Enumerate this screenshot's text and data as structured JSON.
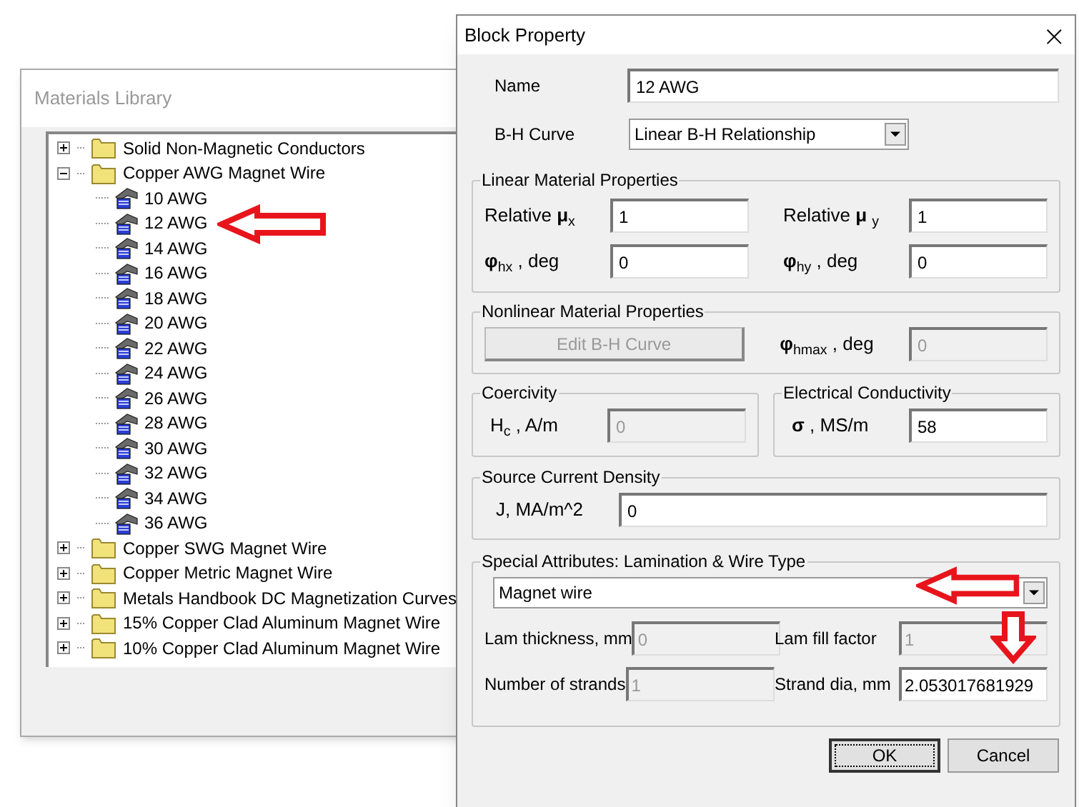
{
  "materials_library": {
    "title": "Materials Library",
    "tree": [
      {
        "label": "Solid Non-Magnetic Conductors",
        "expanded": false
      },
      {
        "label": "Copper AWG Magnet Wire",
        "expanded": true,
        "children": [
          {
            "label": "10 AWG",
            "marked": false
          },
          {
            "label": "12 AWG",
            "marked": true
          },
          {
            "label": "14 AWG",
            "marked": false
          },
          {
            "label": "16 AWG",
            "marked": false
          },
          {
            "label": "18 AWG",
            "marked": false
          },
          {
            "label": "20 AWG",
            "marked": false
          },
          {
            "label": "22 AWG",
            "marked": false
          },
          {
            "label": "24 AWG",
            "marked": false
          },
          {
            "label": "26 AWG",
            "marked": false
          },
          {
            "label": "28 AWG",
            "marked": false
          },
          {
            "label": "30 AWG",
            "marked": false
          },
          {
            "label": "32 AWG",
            "marked": false
          },
          {
            "label": "34 AWG",
            "marked": false
          },
          {
            "label": "36 AWG",
            "marked": false
          }
        ]
      },
      {
        "label": "Copper SWG Magnet Wire",
        "expanded": false
      },
      {
        "label": "Copper Metric Magnet Wire",
        "expanded": false
      },
      {
        "label": "Metals Handbook DC Magnetization Curves",
        "expanded": false
      },
      {
        "label": "15% Copper Clad Aluminum Magnet Wire",
        "expanded": false
      },
      {
        "label": "10% Copper Clad Aluminum Magnet Wire",
        "expanded": false
      }
    ]
  },
  "block_property": {
    "title": "Block Property",
    "close": "×",
    "name": {
      "label": "Name",
      "value": "12 AWG"
    },
    "bh_curve": {
      "label": "B-H Curve",
      "value": "Linear B-H Relationship"
    },
    "linear": {
      "title": "Linear Material Properties",
      "fields": [
        {
          "label": "Relative **μ**$_{x}$",
          "value": "1",
          "disabled": false
        },
        {
          "label": "Relative **μ** $_{y}$",
          "value": "1",
          "disabled": false
        },
        {
          "label": "**φ**$_{hx}$ , deg",
          "value": "0",
          "disabled": false
        },
        {
          "label": "**φ**$_{hy}$ , deg",
          "value": "0",
          "disabled": false
        }
      ]
    },
    "nonlinear": {
      "title": "Nonlinear Material Properties",
      "button": {
        "label": "Edit B-H Curve",
        "disabled": true
      },
      "field": {
        "label": "**φ**$_{hmax}$ , deg",
        "value": "0",
        "disabled": true
      }
    },
    "coercivity": {
      "title": "Coercivity",
      "label": "H$_{c}$ , A/m",
      "value": "0",
      "disabled": true
    },
    "conductivity": {
      "title": "Electrical Conductivity",
      "label": "**σ** , MS/m",
      "value": "58",
      "disabled": false
    },
    "source_current": {
      "title": "Source Current Density",
      "label": "J, MA/m^2",
      "value": "0",
      "disabled": false
    },
    "special": {
      "title": "Special Attributes:  Lamination & Wire Type",
      "dropdown": {
        "value": "Magnet wire",
        "marked": true
      },
      "fields": [
        {
          "label": "Lam thickness, mm",
          "value": "0",
          "disabled": true,
          "marked": false
        },
        {
          "label": "Lam fill factor",
          "value": "1",
          "disabled": true,
          "marked": false
        },
        {
          "label": "Number of strands",
          "value": "1",
          "disabled": true,
          "marked": false
        },
        {
          "label": "Strand dia, mm",
          "value": "2.053017681929",
          "disabled": false,
          "marked": true
        }
      ]
    },
    "buttons": [
      {
        "label": "OK",
        "default": true
      },
      {
        "label": "Cancel",
        "default": false
      }
    ]
  }
}
